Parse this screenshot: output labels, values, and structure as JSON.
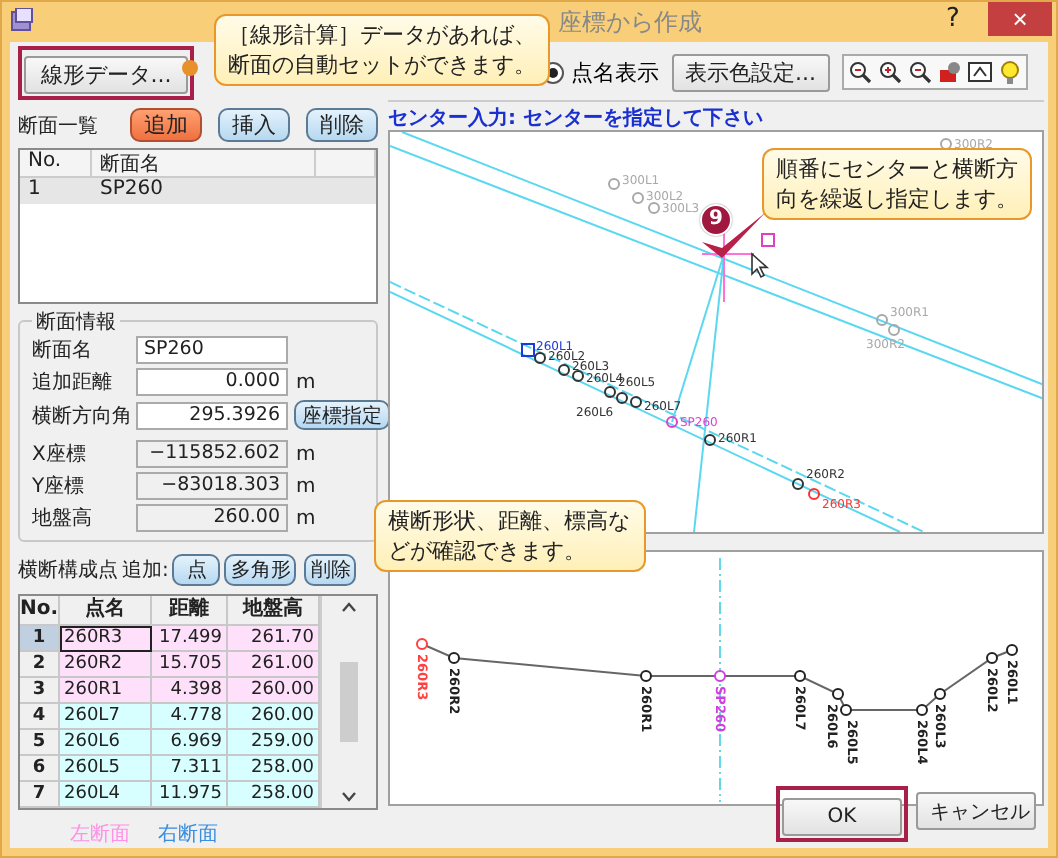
{
  "window": {
    "title": "座標から作成",
    "help_button": "?",
    "close_button": "×"
  },
  "toolbar": {
    "alignment_button": "線形データ...",
    "name_display": {
      "label": "点名表示",
      "selected": true
    },
    "color_button": "表示色設定..."
  },
  "section_list": {
    "title": "断面一覧",
    "buttons": [
      {
        "label": "追加",
        "highlighted": true
      },
      {
        "label": "挿入",
        "highlighted": false
      },
      {
        "label": "削除",
        "highlighted": false
      }
    ],
    "columns": [
      "No.",
      "断面名"
    ],
    "rows": [
      {
        "no": "1",
        "name": "SP260",
        "selected": true
      }
    ]
  },
  "section_info": {
    "title": "断面情報",
    "fields": [
      {
        "label": "断面名",
        "value": "SP260",
        "kind": "input"
      },
      {
        "label": "追加距離",
        "value": "0.000",
        "unit": "m",
        "kind": "input"
      },
      {
        "label": "横断方向角",
        "value": "295.3926",
        "button": "座標指定",
        "kind": "input"
      },
      {
        "label": "X座標",
        "value": "−115852.602",
        "unit": "m",
        "kind": "readonly"
      },
      {
        "label": "Y座標",
        "value": "−83018.303",
        "unit": "m",
        "kind": "readonly"
      },
      {
        "label": "地盤高",
        "value": "260.00",
        "unit": "m",
        "kind": "readonly"
      }
    ]
  },
  "points": {
    "title": "横断構成点",
    "add_label": "追加:",
    "buttons": [
      "点",
      "多角形",
      "削除"
    ],
    "columns": [
      "No.",
      "点名",
      "距離",
      "地盤高"
    ],
    "rows": [
      {
        "no": "1",
        "name": "260R3",
        "distance": "17.499",
        "elevation": "261.70",
        "color": "#ffe0fa",
        "selected": true
      },
      {
        "no": "2",
        "name": "260R2",
        "distance": "15.705",
        "elevation": "261.00",
        "color": "#ffe0fa",
        "selected": false
      },
      {
        "no": "3",
        "name": "260R1",
        "distance": "4.398",
        "elevation": "260.00",
        "color": "#ffe0fa",
        "selected": false
      },
      {
        "no": "4",
        "name": "260L7",
        "distance": "4.778",
        "elevation": "260.00",
        "color": "#d8ffff",
        "selected": false
      },
      {
        "no": "5",
        "name": "260L6",
        "distance": "6.969",
        "elevation": "259.00",
        "color": "#d8ffff",
        "selected": false
      },
      {
        "no": "6",
        "name": "260L5",
        "distance": "7.311",
        "elevation": "258.00",
        "color": "#d8ffff",
        "selected": false
      },
      {
        "no": "7",
        "name": "260L4",
        "distance": "11.975",
        "elevation": "258.00",
        "color": "#d8ffff",
        "selected": false
      }
    ]
  },
  "legend": [
    {
      "label": "左断面",
      "color": "#ff90e8"
    },
    {
      "label": "右断面",
      "color": "#3a8ee0"
    }
  ],
  "map": {
    "prompt": "センター入力: センターを指定して下さい",
    "step": "9",
    "points": [
      {
        "label": "300L1",
        "kind": "faint"
      },
      {
        "label": "300L2",
        "kind": "faint"
      },
      {
        "label": "300L3",
        "kind": "faint"
      },
      {
        "label": "300R1",
        "kind": "faint"
      },
      {
        "label": "300R2",
        "kind": "faint"
      },
      {
        "label": "300R2",
        "kind": "faint"
      },
      {
        "label": "260L1",
        "kind": "start"
      },
      {
        "label": "260L2",
        "kind": "point"
      },
      {
        "label": "260L3",
        "kind": "point"
      },
      {
        "label": "260L4",
        "kind": "point"
      },
      {
        "label": "260L5",
        "kind": "point"
      },
      {
        "label": "260L6",
        "kind": "point"
      },
      {
        "label": "260L7",
        "kind": "point"
      },
      {
        "label": "SP260",
        "kind": "center"
      },
      {
        "label": "260R1",
        "kind": "point"
      },
      {
        "label": "260R2",
        "kind": "point"
      },
      {
        "label": "260R3",
        "kind": "end"
      }
    ]
  },
  "profile": {
    "points": [
      {
        "label": "260R3",
        "kind": "end"
      },
      {
        "label": "260R2",
        "kind": "point"
      },
      {
        "label": "260R1",
        "kind": "point"
      },
      {
        "label": "SP260",
        "kind": "center"
      },
      {
        "label": "260L7",
        "kind": "point"
      },
      {
        "label": "260L6",
        "kind": "point"
      },
      {
        "label": "260L5",
        "kind": "point"
      },
      {
        "label": "260L4",
        "kind": "point"
      },
      {
        "label": "260L3",
        "kind": "point"
      },
      {
        "label": "260L2",
        "kind": "point"
      },
      {
        "label": "260L1",
        "kind": "point"
      }
    ]
  },
  "callouts": [
    {
      "lines": [
        "［線形計算］データがあれば、",
        "断面の自動セットができます。"
      ]
    },
    {
      "lines": [
        "順番にセンターと横断方",
        "向を繰返し指定します。"
      ]
    },
    {
      "lines": [
        "横断形状、距離、標高な",
        "どが確認できます。"
      ]
    }
  ],
  "buttons": [
    {
      "label": "OK",
      "highlighted": true
    },
    {
      "label": "キャンセル",
      "highlighted": false
    }
  ]
}
